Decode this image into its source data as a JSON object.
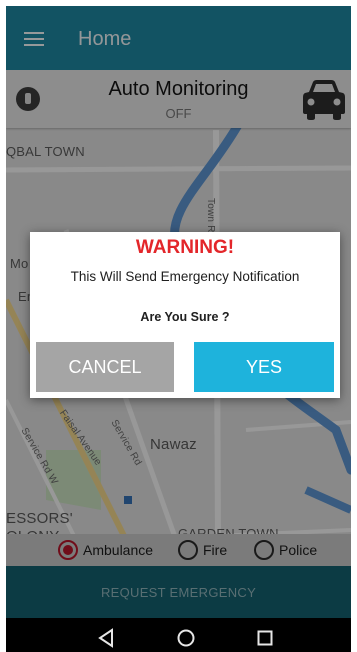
{
  "app_bar": {
    "title": "Home",
    "menu_icon": "hamburger-menu-icon"
  },
  "auto_monitoring": {
    "title": "Auto Monitoring",
    "status": "OFF",
    "compass_icon": "compass-icon",
    "car_icon": "car-icon"
  },
  "map": {
    "labels": {
      "iqbal_town": "QBAL TOWN",
      "road_1": "Town Rd",
      "mo": "Mo",
      "er": "Er",
      "faisal_avenue": "Faisal Avenue",
      "service_rd": "Service Rd",
      "service_rd_w": "Service Rd W",
      "nawaz": "Nawaz",
      "essors": "ESSORS'",
      "olony": "OLONY",
      "garden_town": "GARDEN TOWN"
    }
  },
  "dialog": {
    "title": "WARNING!",
    "message": "This Will Send Emergency Notification",
    "question": "Are You Sure ?",
    "cancel_label": "CANCEL",
    "yes_label": "YES"
  },
  "services": {
    "selected": "Ambulance",
    "options": [
      {
        "label": "Ambulance",
        "checked": true
      },
      {
        "label": "Fire",
        "checked": false
      },
      {
        "label": "Police",
        "checked": false
      }
    ]
  },
  "request_button": {
    "label": "REQUEST EMERGENCY"
  },
  "nav_bar": {
    "back_icon": "back-triangle-icon",
    "home_icon": "home-circle-icon",
    "recents_icon": "recents-square-icon"
  },
  "colors": {
    "primary": "#1e87a1",
    "warning": "#e3262a",
    "yes_button": "#1eb3dc",
    "cancel_button": "#a5a5a5",
    "radio_checked": "#b5162a"
  }
}
